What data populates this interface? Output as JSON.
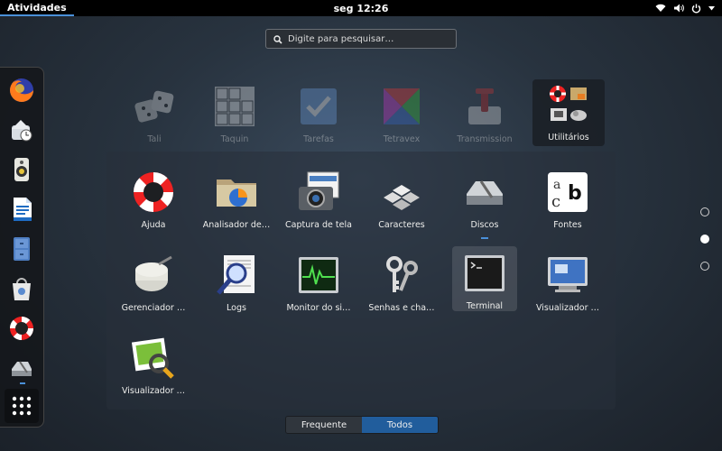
{
  "topbar": {
    "activities": "Atividades",
    "clock": "seg 12:26"
  },
  "search": {
    "placeholder": "Digite para pesquisar…"
  },
  "dash": {
    "items": [
      {
        "name": "firefox-icon"
      },
      {
        "name": "clock-icon"
      },
      {
        "name": "speaker-icon"
      },
      {
        "name": "writer-icon"
      },
      {
        "name": "files-icon"
      },
      {
        "name": "software-icon"
      },
      {
        "name": "help-icon"
      },
      {
        "name": "disks-icon"
      }
    ],
    "show_apps": "show-applications-icon"
  },
  "grid_top": [
    {
      "label": "Tali"
    },
    {
      "label": "Taquin"
    },
    {
      "label": "Tarefas"
    },
    {
      "label": "Tetravex"
    },
    {
      "label": "Transmission"
    },
    {
      "label": "Utilitários"
    }
  ],
  "folder_apps": [
    {
      "label": "Ajuda"
    },
    {
      "label": "Analisador de…"
    },
    {
      "label": "Captura de tela"
    },
    {
      "label": "Caracteres"
    },
    {
      "label": "Discos"
    },
    {
      "label": "Fontes"
    },
    {
      "label": "Gerenciador …"
    },
    {
      "label": "Logs"
    },
    {
      "label": "Monitor do si…"
    },
    {
      "label": "Senhas e cha…"
    },
    {
      "label": "Terminal"
    },
    {
      "label": "Visualizador …"
    },
    {
      "label": "Visualizador …"
    }
  ],
  "switcher": {
    "frequent": "Frequente",
    "all": "Todos"
  },
  "colors": {
    "accent": "#4a90d9",
    "switch_active": "#215d9c"
  }
}
